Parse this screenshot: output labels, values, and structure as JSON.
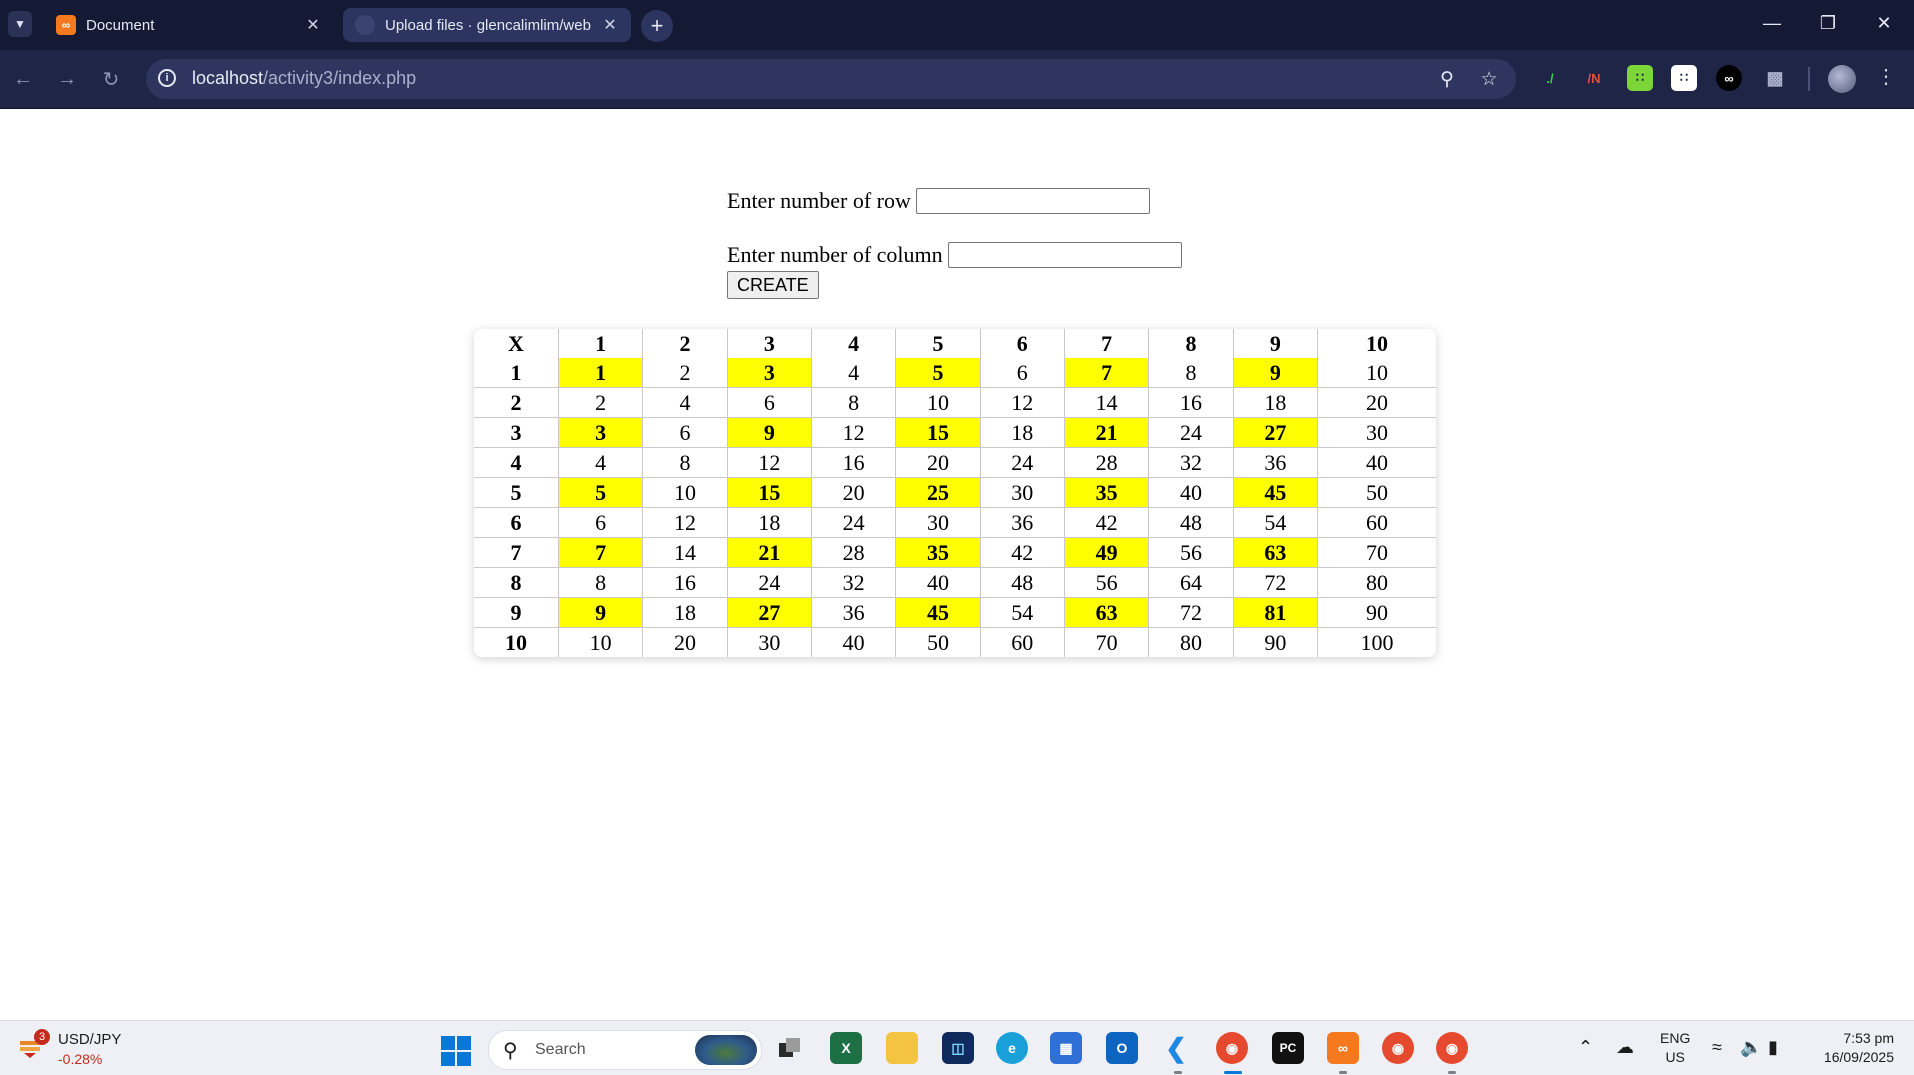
{
  "browser": {
    "tabs": [
      {
        "title": "Document",
        "favicon": "xampp-icon",
        "active": true
      },
      {
        "title": "Upload files · glencalimlim/web",
        "favicon": "github-icon",
        "active": false
      }
    ],
    "url_host": "localhost",
    "url_path": "/activity3/index.php"
  },
  "form": {
    "row_label": "Enter number of row",
    "row_value": "",
    "column_label": "Enter number of column",
    "column_value": "",
    "create_label": "CREATE"
  },
  "table": {
    "corner": "X",
    "highlight_color": "#ffff00",
    "columns": [
      "1",
      "2",
      "3",
      "4",
      "5",
      "6",
      "7",
      "8",
      "9",
      "10"
    ],
    "rows": [
      {
        "header": "1",
        "cells": [
          "1",
          "2",
          "3",
          "4",
          "5",
          "6",
          "7",
          "8",
          "9",
          "10"
        ]
      },
      {
        "header": "2",
        "cells": [
          "2",
          "4",
          "6",
          "8",
          "10",
          "12",
          "14",
          "16",
          "18",
          "20"
        ]
      },
      {
        "header": "3",
        "cells": [
          "3",
          "6",
          "9",
          "12",
          "15",
          "18",
          "21",
          "24",
          "27",
          "30"
        ]
      },
      {
        "header": "4",
        "cells": [
          "4",
          "8",
          "12",
          "16",
          "20",
          "24",
          "28",
          "32",
          "36",
          "40"
        ]
      },
      {
        "header": "5",
        "cells": [
          "5",
          "10",
          "15",
          "20",
          "25",
          "30",
          "35",
          "40",
          "45",
          "50"
        ]
      },
      {
        "header": "6",
        "cells": [
          "6",
          "12",
          "18",
          "24",
          "30",
          "36",
          "42",
          "48",
          "54",
          "60"
        ]
      },
      {
        "header": "7",
        "cells": [
          "7",
          "14",
          "21",
          "28",
          "35",
          "42",
          "49",
          "56",
          "63",
          "70"
        ]
      },
      {
        "header": "8",
        "cells": [
          "8",
          "16",
          "24",
          "32",
          "40",
          "48",
          "56",
          "64",
          "72",
          "80"
        ]
      },
      {
        "header": "9",
        "cells": [
          "9",
          "18",
          "27",
          "36",
          "45",
          "54",
          "63",
          "72",
          "81",
          "90"
        ]
      },
      {
        "header": "10",
        "cells": [
          "10",
          "20",
          "30",
          "40",
          "50",
          "60",
          "70",
          "80",
          "90",
          "100"
        ]
      }
    ]
  },
  "taskbar": {
    "ticker_name": "USD/JPY",
    "ticker_change": "-0.28%",
    "ticker_badge": "3",
    "search_placeholder": "Search",
    "lang_line1": "ENG",
    "lang_line2": "US",
    "time": "7:53 pm",
    "date": "16/09/2025"
  }
}
